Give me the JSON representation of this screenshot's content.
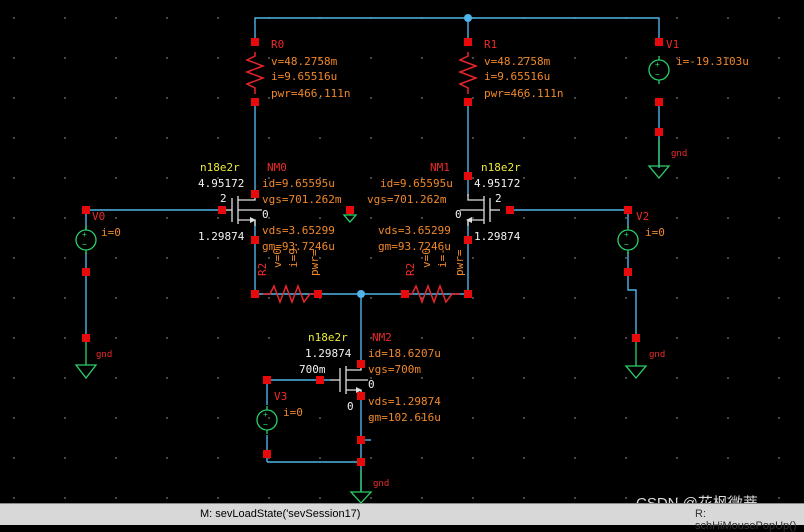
{
  "colors": {
    "wire": "#4fb4e8",
    "pin": "#e80a0a",
    "label": "#ee2a2a",
    "value": "#f0882a",
    "model": "#eaea3a",
    "ground": "#2bd16a",
    "background": "#000000"
  },
  "resistors": {
    "r0": {
      "name": "R0",
      "v": "v=48.2758m",
      "i": "i=9.65516u",
      "pwr": "pwr=466.111n"
    },
    "r1": {
      "name": "R1",
      "v": "v=48.2758m",
      "i": "i=9.65516u",
      "pwr": "pwr=466.111n"
    },
    "r2a": {
      "name": "R2",
      "v": "v=0",
      "i": "i=9.",
      "pwr": "pwr="
    },
    "r2b": {
      "name": "R2",
      "v": "v=0",
      "i": "i=-",
      "pwr": "pwr="
    }
  },
  "sources": {
    "v0": {
      "name": "V0",
      "i": "i=0"
    },
    "v1": {
      "name": "V1",
      "i": "i=-19.3103u"
    },
    "v2": {
      "name": "V2",
      "i": "i=0"
    },
    "v3": {
      "name": "V3",
      "i": "i=0"
    }
  },
  "transistors": {
    "nm0": {
      "name": "NM0",
      "model": "n18e2r",
      "w": "4.95172",
      "l": "1.29874",
      "id": "id=9.65595u",
      "vgs": "vgs=701.262m",
      "vds": "vds=3.65299",
      "gm": "gm=93.7246u",
      "term_g": "2",
      "term_b": "0"
    },
    "nm1": {
      "name": "NM1",
      "model": "n18e2r",
      "w": "4.95172",
      "l": "1.29874",
      "id": "id=9.65595u",
      "vgs": "vgs=701.262m",
      "vds": "vds=3.65299",
      "gm": "gm=93.7246u",
      "term_g": "2",
      "term_b": "0"
    },
    "nm2": {
      "name": "NM2",
      "model": "n18e2r",
      "w": "1.29874",
      "l": "700m",
      "id": "id=18.6207u",
      "vgs": "vgs=700m",
      "vds": "vds=1.29874",
      "gm": "gm=102.616u",
      "term_a": "0",
      "term_b": "0"
    }
  },
  "ground_label": "gnd",
  "status": {
    "left": "M: sevLoadState('sevSession17)",
    "right": "R: schHiMousePopUp()"
  },
  "watermark": "CSDN @花枫微蒂"
}
